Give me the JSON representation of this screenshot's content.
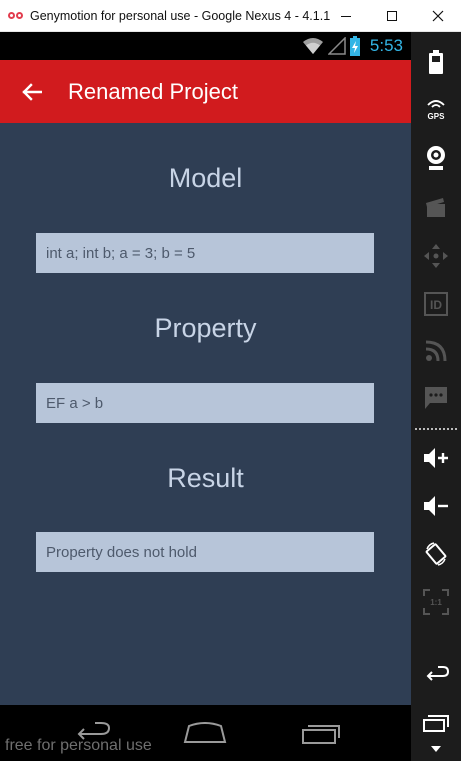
{
  "window": {
    "title": "Genymotion for personal use - Google Nexus 4 - 4.1.1..."
  },
  "status_bar": {
    "time": "5:53"
  },
  "action_bar": {
    "title": "Renamed Project"
  },
  "sections": {
    "model": {
      "heading": "Model",
      "value": "int a; int b; a = 3; b = 5"
    },
    "property": {
      "heading": "Property",
      "value": "EF a > b"
    },
    "result": {
      "heading": "Result",
      "value": "Property does not hold"
    }
  },
  "watermark": "free for personal use",
  "sidebar": {
    "gps_label": "GPS",
    "id_label": "ID",
    "pixel_label": "1:1"
  },
  "colors": {
    "action_bar": "#d11b1e",
    "background": "#2f3e54",
    "field": "#b7c5d9",
    "heading": "#c8d4e6",
    "clock": "#33b5e5"
  }
}
